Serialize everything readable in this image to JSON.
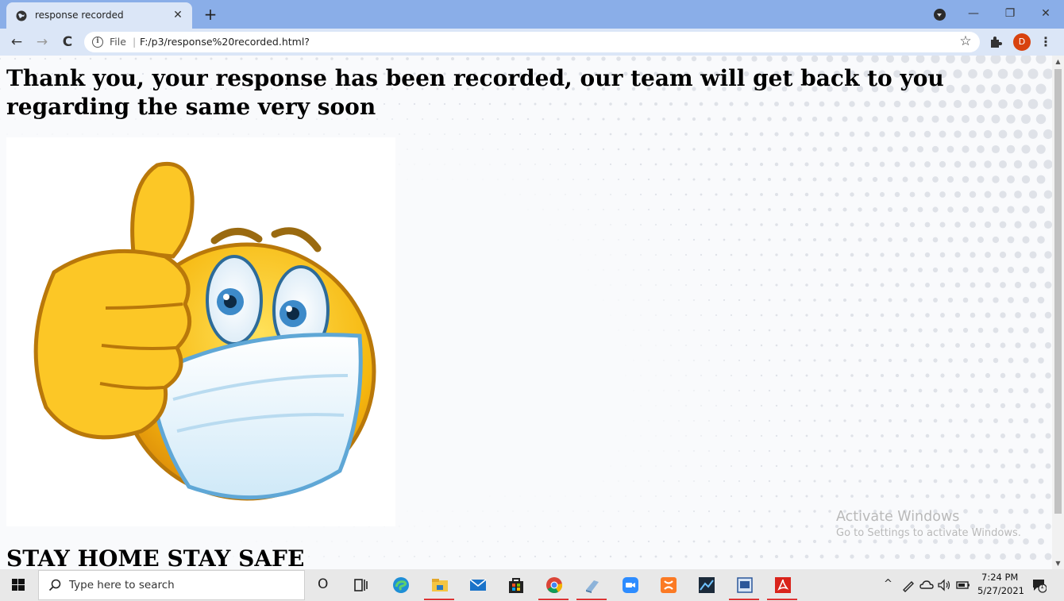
{
  "browser": {
    "tab_title": "response recorded",
    "tab_close": "✕",
    "new_tab": "+",
    "window_minimize": "—",
    "window_restore": "❐",
    "window_close": "✕",
    "back": "←",
    "forward": "→",
    "reload": "C",
    "info_glyph": "i",
    "scheme_label": "File",
    "separator": "|",
    "url": "F:/p3/response%20recorded.html?",
    "star": "☆",
    "profile_initial": "D",
    "menu": "⋮",
    "accent_color": "#8aaee8"
  },
  "page": {
    "heading": "Thank you, your response has been recorded, our team will get back to you regarding the same very soon",
    "footer_text": "STAY HOME STAY SAFE",
    "image_subject": "thumbs-up emoji wearing face mask",
    "watermark_title": "Activate Windows",
    "watermark_subtitle": "Go to Settings to activate Windows."
  },
  "scrollbar": {
    "up": "▲",
    "down": "▼"
  },
  "taskbar": {
    "search_placeholder": "Type here to search",
    "cortana": "O",
    "tray_chevron": "^",
    "time": "7:24 PM",
    "date": "5/27/2021",
    "notification_count": "1",
    "apps": [
      "task-view",
      "edge",
      "file-explorer",
      "mail",
      "store",
      "chrome",
      "app-book",
      "zoom",
      "xampp",
      "photo-editor",
      "word",
      "acrobat"
    ]
  }
}
